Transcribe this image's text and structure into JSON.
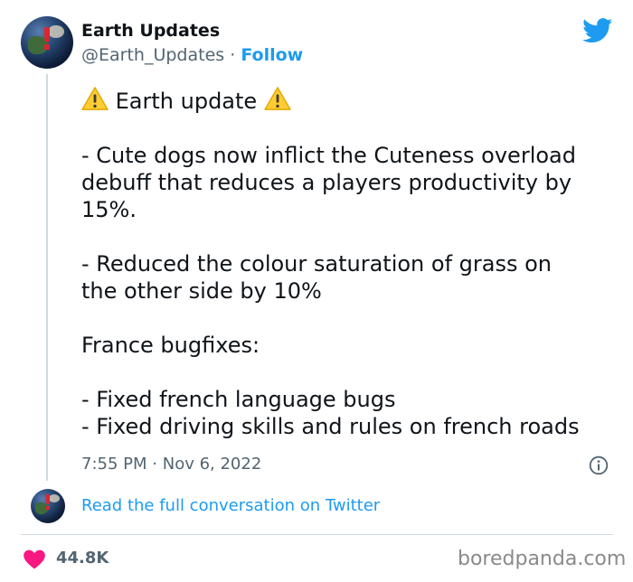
{
  "account": {
    "name": "Earth Updates",
    "handle": "@Earth_Updates",
    "separator": "·",
    "follow_label": "Follow"
  },
  "tweet": {
    "title": "Earth update",
    "lines": [
      "- Cute dogs now inflict the Cuteness overload",
      "debuff that reduces a players productivity by",
      "15%.",
      "- Reduced the colour saturation of grass on",
      "the other side by 10%",
      "France bugfixes:",
      "- Fixed french language bugs",
      "- Fixed driving skills and rules on french roads"
    ],
    "time": "7:55 PM",
    "date_separator": "·",
    "date": "Nov 6, 2022"
  },
  "conversation": {
    "link_label": "Read the full conversation on Twitter"
  },
  "footer": {
    "likes": "44.8K",
    "watermark": "boredpanda.com"
  },
  "icons": {
    "avatar": "earth-globe-avatar",
    "warning": "warning-emoji-icon",
    "brand": "twitter-bird-icon",
    "info": "info-icon",
    "like": "heart-icon"
  },
  "colors": {
    "accent": "#1d9bf0",
    "text": "#0f1419",
    "muted": "#536471",
    "heart": "#f91880",
    "warning": "#ffcc33"
  }
}
